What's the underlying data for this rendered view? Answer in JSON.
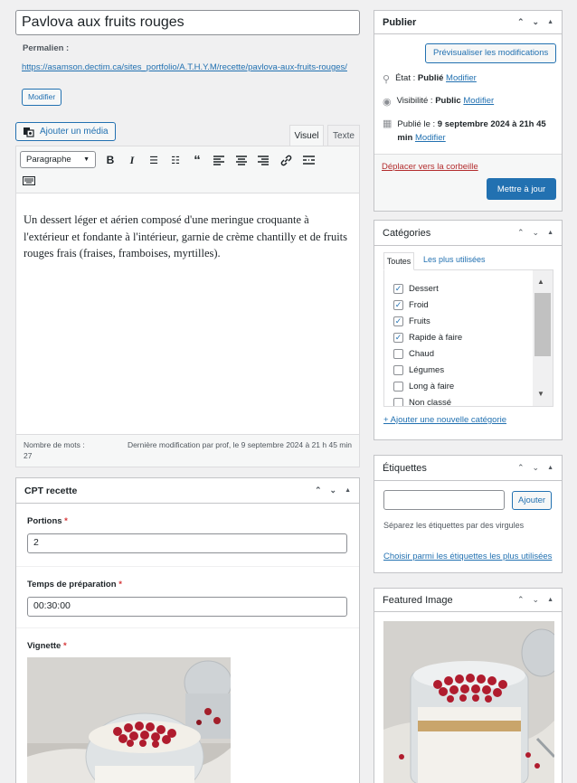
{
  "post": {
    "title": "Pavlova aux fruits rouges",
    "permalink_label": "Permalien :",
    "permalink_url": "https://asamson.dectim.ca/sites_portfolio/A.T.H.Y.M/recette/pavlova-aux-fruits-rouges/",
    "permalink_edit": "Modifier"
  },
  "editor": {
    "add_media": "Ajouter un média",
    "tab_visual": "Visuel",
    "tab_text": "Texte",
    "format_select": "Paragraphe",
    "content": "Un dessert léger et aérien composé d'une meringue croquante à l'extérieur et fondante à l'intérieur, garnie de crème chantilly et de fruits rouges frais (fraises, framboises, myrtilles).",
    "word_count_label": "Nombre de mots :",
    "word_count": "27",
    "last_modified": "Dernière modification par prof, le 9 septembre 2024 à 21 h 45 min"
  },
  "cpt": {
    "title": "CPT recette",
    "portions_label": "Portions",
    "portions_value": "2",
    "prep_label": "Temps de préparation",
    "prep_value": "00:30:00",
    "thumb_label": "Vignette",
    "required": "*"
  },
  "publish": {
    "title": "Publier",
    "preview": "Prévisualiser les modifications",
    "status_label": "État :",
    "status_value": "Publié",
    "visibility_label": "Visibilité :",
    "visibility_value": "Public",
    "published_label": "Publié le :",
    "published_value": "9 septembre 2024 à 21h 45 min",
    "edit": "Modifier",
    "trash": "Déplacer vers la corbeille",
    "update": "Mettre à jour"
  },
  "categories": {
    "title": "Catégories",
    "tab_all": "Toutes",
    "tab_most": "Les plus utilisées",
    "items": [
      {
        "label": "Dessert",
        "checked": true
      },
      {
        "label": "Froid",
        "checked": true
      },
      {
        "label": "Fruits",
        "checked": true
      },
      {
        "label": "Rapide à faire",
        "checked": true
      },
      {
        "label": "Chaud",
        "checked": false
      },
      {
        "label": "Légumes",
        "checked": false
      },
      {
        "label": "Long à faire",
        "checked": false
      },
      {
        "label": "Non classé",
        "checked": false
      }
    ],
    "add_new": "+ Ajouter une nouvelle catégorie"
  },
  "tags": {
    "title": "Étiquettes",
    "add_button": "Ajouter",
    "help": "Séparez les étiquettes par des virgules",
    "choose": "Choisir parmi les étiquettes les plus utilisées"
  },
  "featured": {
    "title": "Featured Image"
  },
  "colors": {
    "accent": "#2271b1",
    "danger": "#d63638"
  }
}
